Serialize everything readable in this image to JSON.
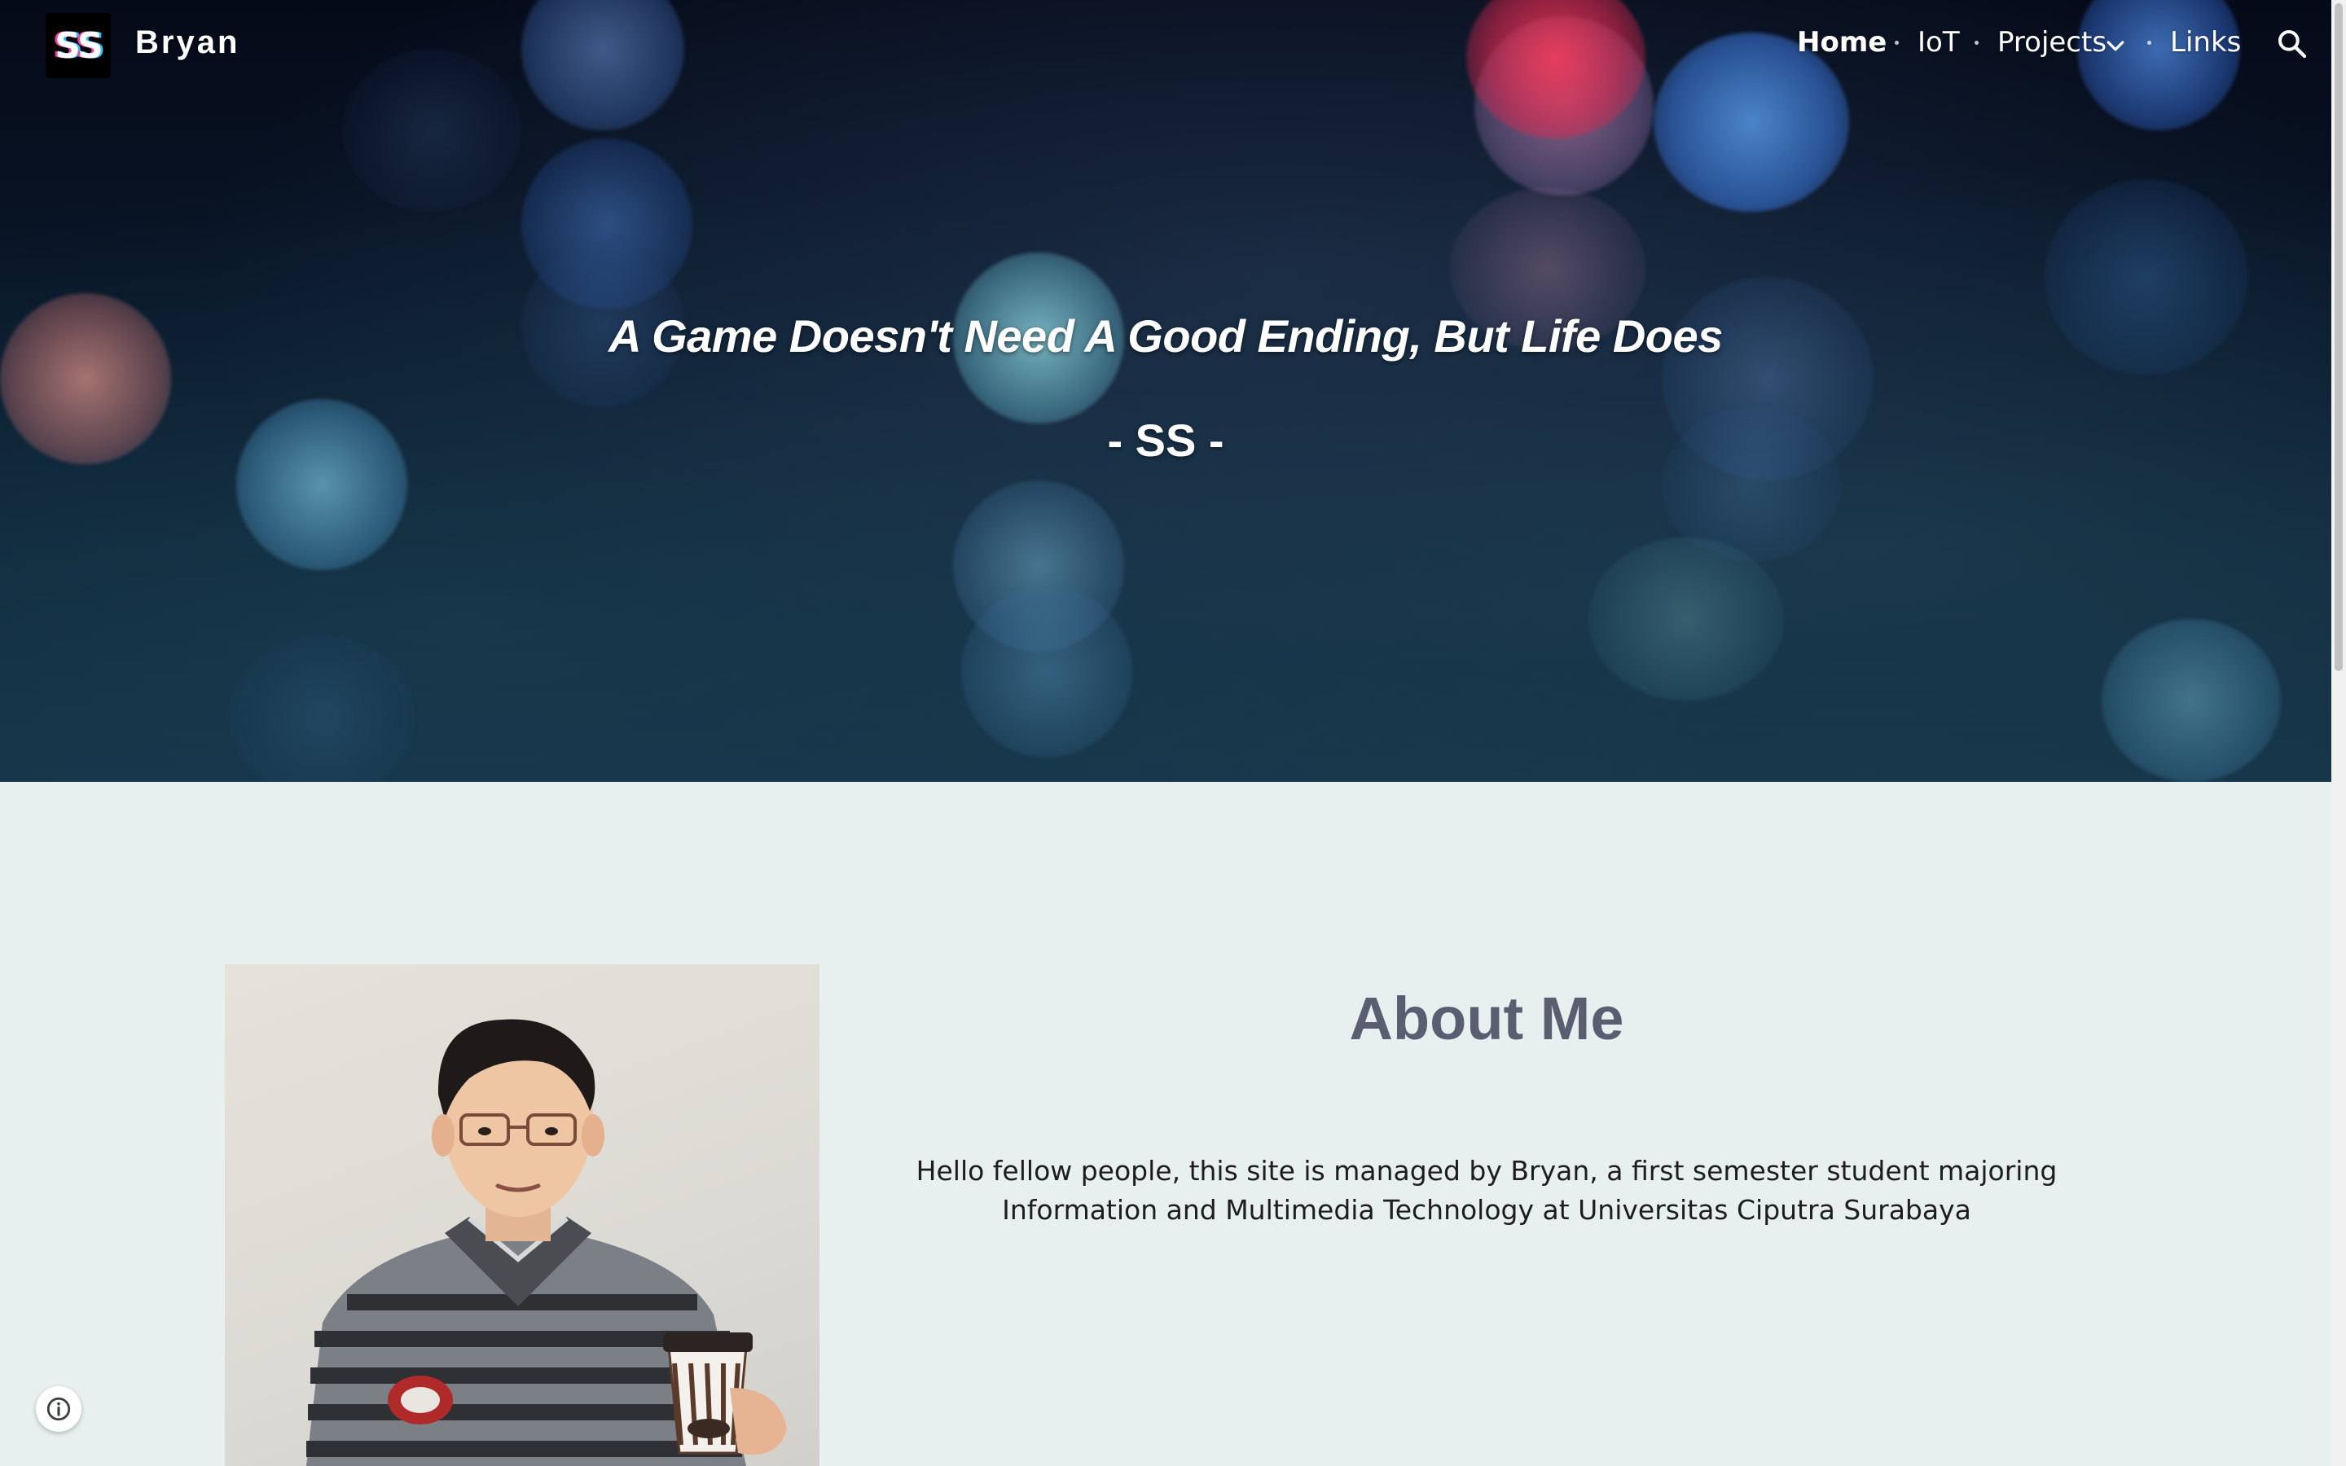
{
  "header": {
    "logo_text": "SS",
    "site_name": "Bryan",
    "nav": {
      "home": "Home",
      "iot": "IoT",
      "projects": "Projects",
      "links": "Links"
    }
  },
  "hero": {
    "quote": "A Game Doesn't Need A Good Ending, But Life Does",
    "signature": "- SS -"
  },
  "about": {
    "title": "About Me",
    "text": "Hello fellow people, this site is managed by Bryan, a first semester student majoring Information and Multimedia Technology at Universitas Ciputra Surabaya"
  },
  "icons": {
    "search": "search-icon",
    "chevron": "chevron-down-icon",
    "info": "info-icon"
  },
  "colors": {
    "page_background": "#e8f0ef",
    "about_title": "#5a5e70",
    "logo_pink": "#e8459b",
    "logo_blue": "#3fb6ff"
  }
}
